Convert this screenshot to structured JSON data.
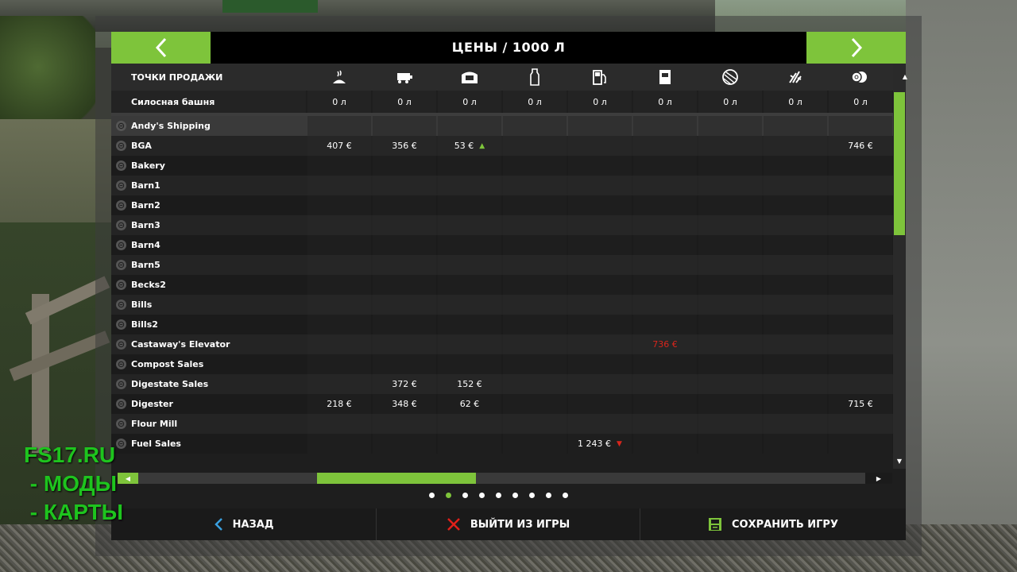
{
  "title": "ЦЕНЫ / 1000 Л",
  "header": {
    "sell_points_label": "ТОЧКИ ПРОДАЖИ",
    "columns": [
      {
        "icon": "manure-icon"
      },
      {
        "icon": "seeds-icon"
      },
      {
        "icon": "fertilizer-icon"
      },
      {
        "icon": "milk-icon"
      },
      {
        "icon": "fuel-icon"
      },
      {
        "icon": "bag-icon"
      },
      {
        "icon": "wool-icon"
      },
      {
        "icon": "grass-icon"
      },
      {
        "icon": "bale-icon"
      }
    ]
  },
  "silo": {
    "label": "Силосная башня",
    "values": [
      "0 л",
      "0 л",
      "0 л",
      "0 л",
      "0 л",
      "0 л",
      "0 л",
      "0 л",
      "0 л"
    ]
  },
  "rows": [
    {
      "name": "Andy's Shipping",
      "values": [
        "",
        "",
        "",
        "",
        "",
        "",
        "",
        "",
        ""
      ],
      "selected": true
    },
    {
      "name": "BGA",
      "values": [
        "407 €",
        "356 €",
        "53 €",
        "",
        "",
        "",
        "",
        "",
        "746 €"
      ],
      "trend": {
        "2": "up"
      }
    },
    {
      "name": "Bakery",
      "values": [
        "",
        "",
        "",
        "",
        "",
        "",
        "",
        "",
        ""
      ]
    },
    {
      "name": "Barn1",
      "values": [
        "",
        "",
        "",
        "",
        "",
        "",
        "",
        "",
        ""
      ]
    },
    {
      "name": "Barn2",
      "values": [
        "",
        "",
        "",
        "",
        "",
        "",
        "",
        "",
        ""
      ]
    },
    {
      "name": "Barn3",
      "values": [
        "",
        "",
        "",
        "",
        "",
        "",
        "",
        "",
        ""
      ]
    },
    {
      "name": "Barn4",
      "values": [
        "",
        "",
        "",
        "",
        "",
        "",
        "",
        "",
        ""
      ]
    },
    {
      "name": "Barn5",
      "values": [
        "",
        "",
        "",
        "",
        "",
        "",
        "",
        "",
        ""
      ]
    },
    {
      "name": "Becks2",
      "values": [
        "",
        "",
        "",
        "",
        "",
        "",
        "",
        "",
        ""
      ]
    },
    {
      "name": "Bills",
      "values": [
        "",
        "",
        "",
        "",
        "",
        "",
        "",
        "",
        ""
      ]
    },
    {
      "name": "Bills2",
      "values": [
        "",
        "",
        "",
        "",
        "",
        "",
        "",
        "",
        ""
      ]
    },
    {
      "name": "Castaway's Elevator",
      "values": [
        "",
        "",
        "",
        "",
        "",
        "736 €",
        "",
        "",
        ""
      ],
      "red": {
        "5": true
      }
    },
    {
      "name": "Compost Sales",
      "values": [
        "",
        "",
        "",
        "",
        "",
        "",
        "",
        "",
        ""
      ]
    },
    {
      "name": "Digestate Sales",
      "values": [
        "",
        "372 €",
        "152 €",
        "",
        "",
        "",
        "",
        "",
        ""
      ]
    },
    {
      "name": "Digester",
      "values": [
        "218 €",
        "348 €",
        "62 €",
        "",
        "",
        "",
        "",
        "",
        "715 €"
      ]
    },
    {
      "name": "Flour Mill",
      "values": [
        "",
        "",
        "",
        "",
        "",
        "",
        "",
        "",
        ""
      ]
    },
    {
      "name": "Fuel Sales",
      "values": [
        "",
        "",
        "",
        "",
        "1 243 €",
        "",
        "",
        "",
        ""
      ],
      "trend": {
        "4": "down"
      }
    }
  ],
  "pagination": {
    "pages": 9,
    "active": 1
  },
  "footer": {
    "back_label": "НАЗАД",
    "quit_label": "ВЫЙТИ ИЗ ИГРЫ",
    "save_label": "СОХРАНИТЬ ИГРУ"
  },
  "watermark": {
    "line1": "FS17.RU",
    "line2": " - МОДЫ",
    "line3": " - КАРТЫ"
  },
  "colors": {
    "accent": "#7ec43b",
    "down": "#d9251c",
    "watermark": "#1ec41e"
  }
}
